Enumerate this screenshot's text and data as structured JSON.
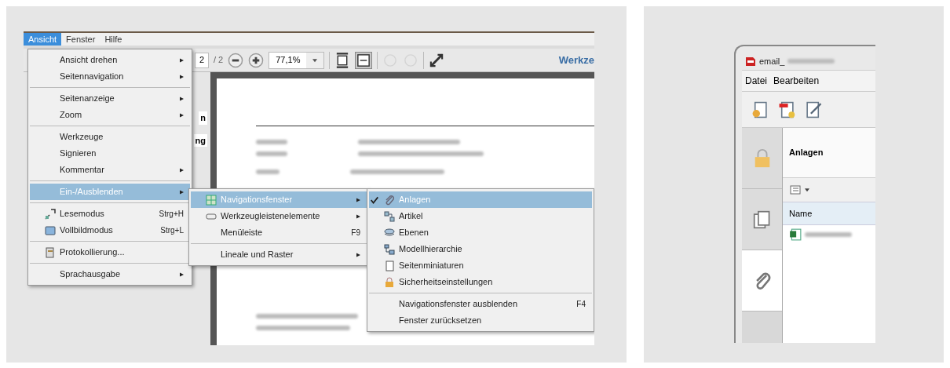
{
  "app_window": {
    "menu_bar": [
      {
        "label": "Ansicht",
        "selected": true
      },
      {
        "label": "Fenster",
        "selected": false
      },
      {
        "label": "Hilfe",
        "selected": false
      }
    ],
    "toolbar": {
      "page_number": "2",
      "page_count": "/ 2",
      "zoom": "77,1%",
      "tools_label": "Werkze"
    },
    "side_panel_fragments": [
      "n",
      "ng"
    ],
    "view_menu": [
      {
        "kind": "item",
        "label": "Ansicht drehen",
        "submenu": true,
        "selected": false
      },
      {
        "kind": "item",
        "label": "Seitennavigation",
        "submenu": true,
        "selected": false
      },
      {
        "kind": "separator"
      },
      {
        "kind": "item",
        "label": "Seitenanzeige",
        "submenu": true,
        "selected": false
      },
      {
        "kind": "item",
        "label": "Zoom",
        "submenu": true,
        "selected": false
      },
      {
        "kind": "separator"
      },
      {
        "kind": "item",
        "label": "Werkzeuge",
        "submenu": false,
        "selected": false
      },
      {
        "kind": "item",
        "label": "Signieren",
        "submenu": false,
        "selected": false
      },
      {
        "kind": "item",
        "label": "Kommentar",
        "submenu": true,
        "selected": false
      },
      {
        "kind": "separator"
      },
      {
        "kind": "item",
        "label": "Ein-/Ausblenden",
        "submenu": true,
        "selected": true
      },
      {
        "kind": "separator"
      },
      {
        "kind": "item",
        "label": "Lesemodus",
        "shortcut": "Strg+H",
        "submenu": false,
        "selected": false
      },
      {
        "kind": "item",
        "label": "Vollbildmodus",
        "shortcut": "Strg+L",
        "submenu": false,
        "selected": false
      },
      {
        "kind": "separator"
      },
      {
        "kind": "item",
        "label": "Protokollierung...",
        "submenu": false,
        "selected": false
      },
      {
        "kind": "separator"
      },
      {
        "kind": "item",
        "label": "Sprachausgabe",
        "submenu": true,
        "selected": false
      }
    ],
    "show_hide_menu": [
      {
        "kind": "item",
        "label": "Navigationsfenster",
        "submenu": true,
        "selected": true
      },
      {
        "kind": "item",
        "label": "Werkzeugleistenelemente",
        "submenu": true,
        "selected": false
      },
      {
        "kind": "item",
        "label": "Menüleiste",
        "shortcut": "F9",
        "submenu": false,
        "selected": false
      },
      {
        "kind": "separator"
      },
      {
        "kind": "item",
        "label": "Lineale und Raster",
        "submenu": true,
        "selected": false
      }
    ],
    "navigation_menu": [
      {
        "kind": "item",
        "label": "Anlagen",
        "checked": true,
        "selected": true
      },
      {
        "kind": "item",
        "label": "Artikel",
        "checked": false,
        "selected": false
      },
      {
        "kind": "item",
        "label": "Ebenen",
        "checked": false,
        "selected": false
      },
      {
        "kind": "item",
        "label": "Modellhierarchie",
        "checked": false,
        "selected": false
      },
      {
        "kind": "item",
        "label": "Seitenminiaturen",
        "checked": false,
        "selected": false
      },
      {
        "kind": "item",
        "label": "Sicherheitseinstellungen",
        "checked": false,
        "selected": false
      },
      {
        "kind": "separator"
      },
      {
        "kind": "item",
        "label": "Navigationsfenster ausblenden",
        "shortcut": "F4",
        "checked": false,
        "selected": false
      },
      {
        "kind": "item",
        "label": "Fenster zurücksetzen",
        "checked": false,
        "selected": false
      }
    ]
  },
  "reader_window": {
    "title": "email_",
    "menu_bar": [
      "Datei",
      "Bearbeiten"
    ],
    "sidebar_tabs": [
      {
        "selected": false
      },
      {
        "selected": false
      },
      {
        "selected": true
      }
    ],
    "panel_title": "Anlagen",
    "column_header": "Name"
  }
}
